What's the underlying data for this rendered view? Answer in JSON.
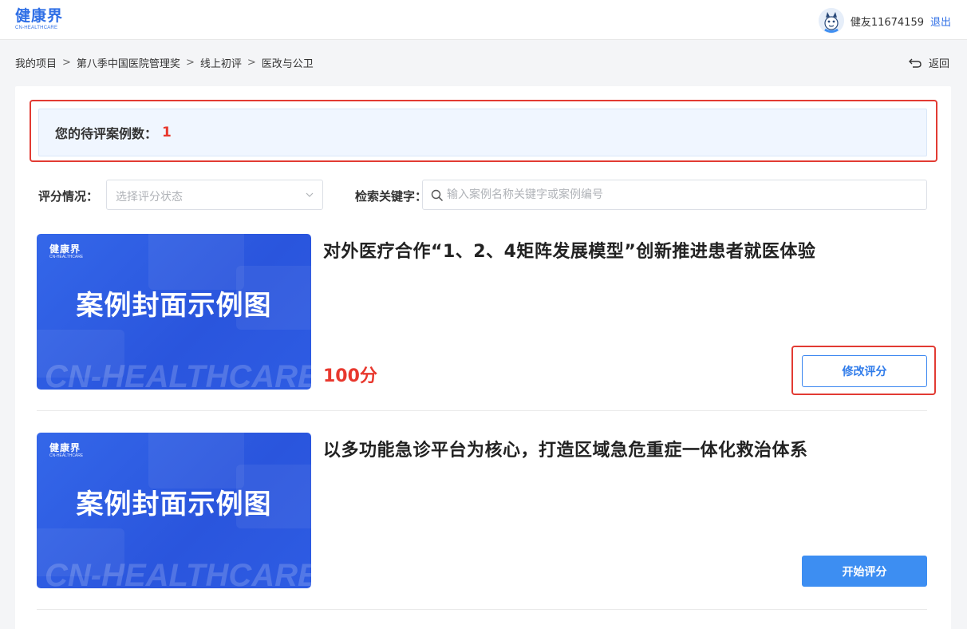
{
  "header": {
    "logo_cn": "健康界",
    "logo_en": "CN-HEALTHCARE",
    "username": "健友11674159",
    "logout": "退出"
  },
  "breadcrumb": [
    "我的项目",
    "第八季中国医院管理奖",
    "线上初评",
    "医改与公卫"
  ],
  "breadcrumb_separator": ">",
  "back_label": "返回",
  "pending": {
    "label": "您的待评案例数：",
    "count": "1"
  },
  "filters": {
    "status_label": "评分情况：",
    "status_placeholder": "选择评分状态",
    "keyword_label": "检索关键字：",
    "keyword_placeholder": "输入案例名称关键字或案例编号"
  },
  "cases": [
    {
      "title": "对外医疗合作“1、2、4矩阵发展模型”创新推进患者就医体验",
      "score": "100分",
      "button": "修改评分",
      "cover_logo_cn": "健康界",
      "cover_logo_en": "CN-HEALTHCARE",
      "cover_title": "案例封面示例图",
      "cover_watermark": "CN-HEALTHCARE"
    },
    {
      "title": "以多功能急诊平台为核心，打造区域急危重症一体化救治体系",
      "score": "",
      "button": "开始评分",
      "cover_logo_cn": "健康界",
      "cover_logo_en": "CN-HEALTHCARE",
      "cover_title": "案例封面示例图",
      "cover_watermark": "CN-HEALTHCARE"
    }
  ],
  "colors": {
    "brand": "#2f6fe6",
    "accent_red": "#e8382e",
    "primary_button": "#3d8ef2",
    "highlight_box": "#e23b33"
  }
}
